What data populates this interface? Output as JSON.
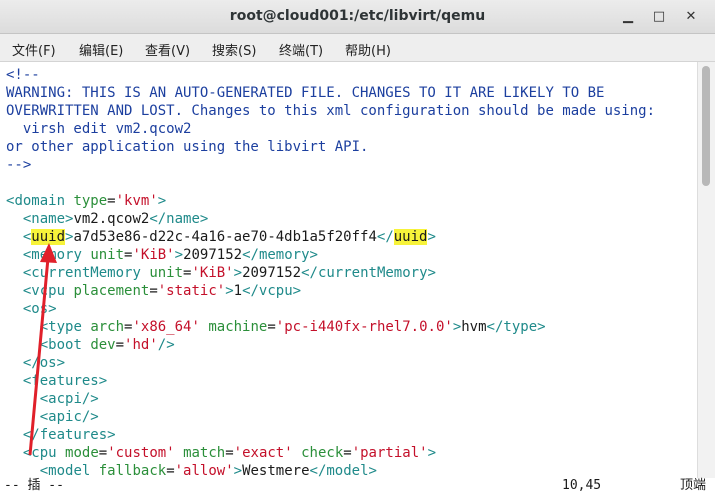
{
  "window": {
    "title": "root@cloud001:/etc/libvirt/qemu"
  },
  "menu": [
    "文件(F)",
    "编辑(E)",
    "查看(V)",
    "搜索(S)",
    "终端(T)",
    "帮助(H)"
  ],
  "editor": {
    "lines": [
      [
        [
          "<!--",
          "c"
        ]
      ],
      [
        [
          "WARNING: THIS IS AN AUTO-GENERATED FILE. CHANGES TO IT ARE LIKELY TO BE",
          "c"
        ]
      ],
      [
        [
          "OVERWRITTEN AND LOST. Changes to this xml configuration should be made using:",
          "c"
        ]
      ],
      [
        [
          "  virsh edit vm2.qcow2",
          "c"
        ]
      ],
      [
        [
          "or other application using the libvirt API.",
          "c"
        ]
      ],
      [
        [
          "-->",
          "c"
        ]
      ],
      [],
      [
        [
          "<",
          "t"
        ],
        [
          "domain",
          "t"
        ],
        [
          " ",
          "x"
        ],
        [
          "type",
          "a"
        ],
        [
          "=",
          "x"
        ],
        [
          "'kvm'",
          "v"
        ],
        [
          ">",
          "t"
        ]
      ],
      [
        [
          "  <",
          "t"
        ],
        [
          "name",
          "t"
        ],
        [
          ">",
          "t"
        ],
        [
          "vm2.qcow2",
          "x"
        ],
        [
          "</",
          "t"
        ],
        [
          "name",
          "t"
        ],
        [
          ">",
          "t"
        ]
      ],
      [
        [
          "  <",
          "t"
        ],
        [
          "uuid",
          "hl"
        ],
        [
          ">",
          "t"
        ],
        [
          "a7d53e86-d22c-4a16-ae70-4db1a5f20ff4",
          "x"
        ],
        [
          "</",
          "t"
        ],
        [
          "uuid",
          "hl"
        ],
        [
          ">",
          "t"
        ]
      ],
      [
        [
          "  <",
          "t"
        ],
        [
          "memory",
          "t"
        ],
        [
          " ",
          "x"
        ],
        [
          "unit",
          "a"
        ],
        [
          "=",
          "x"
        ],
        [
          "'KiB'",
          "v"
        ],
        [
          ">",
          "t"
        ],
        [
          "2097152",
          "x"
        ],
        [
          "</",
          "t"
        ],
        [
          "memory",
          "t"
        ],
        [
          ">",
          "t"
        ]
      ],
      [
        [
          "  <",
          "t"
        ],
        [
          "currentMemory",
          "t"
        ],
        [
          " ",
          "x"
        ],
        [
          "unit",
          "a"
        ],
        [
          "=",
          "x"
        ],
        [
          "'KiB'",
          "v"
        ],
        [
          ">",
          "t"
        ],
        [
          "2097152",
          "x"
        ],
        [
          "</",
          "t"
        ],
        [
          "currentMemory",
          "t"
        ],
        [
          ">",
          "t"
        ]
      ],
      [
        [
          "  <",
          "t"
        ],
        [
          "vcpu",
          "t"
        ],
        [
          " ",
          "x"
        ],
        [
          "placement",
          "a"
        ],
        [
          "=",
          "x"
        ],
        [
          "'static'",
          "v"
        ],
        [
          ">",
          "t"
        ],
        [
          "1",
          "x"
        ],
        [
          "</",
          "t"
        ],
        [
          "vcpu",
          "t"
        ],
        [
          ">",
          "t"
        ]
      ],
      [
        [
          "  <",
          "t"
        ],
        [
          "os",
          "t"
        ],
        [
          ">",
          "t"
        ]
      ],
      [
        [
          "    <",
          "t"
        ],
        [
          "type",
          "t"
        ],
        [
          " ",
          "x"
        ],
        [
          "arch",
          "a"
        ],
        [
          "=",
          "x"
        ],
        [
          "'x86_64'",
          "v"
        ],
        [
          " ",
          "x"
        ],
        [
          "machine",
          "a"
        ],
        [
          "=",
          "x"
        ],
        [
          "'pc-i440fx-rhel7.0.0'",
          "v"
        ],
        [
          ">",
          "t"
        ],
        [
          "hvm",
          "x"
        ],
        [
          "</",
          "t"
        ],
        [
          "type",
          "t"
        ],
        [
          ">",
          "t"
        ]
      ],
      [
        [
          "    <",
          "t"
        ],
        [
          "boot",
          "t"
        ],
        [
          " ",
          "x"
        ],
        [
          "dev",
          "a"
        ],
        [
          "=",
          "x"
        ],
        [
          "'hd'",
          "v"
        ],
        [
          "/>",
          "t"
        ]
      ],
      [
        [
          "  </",
          "t"
        ],
        [
          "os",
          "t"
        ],
        [
          ">",
          "t"
        ]
      ],
      [
        [
          "  <",
          "t"
        ],
        [
          "features",
          "t"
        ],
        [
          ">",
          "t"
        ]
      ],
      [
        [
          "    <",
          "t"
        ],
        [
          "acpi",
          "t"
        ],
        [
          "/>",
          "t"
        ]
      ],
      [
        [
          "    <",
          "t"
        ],
        [
          "apic",
          "t"
        ],
        [
          "/>",
          "t"
        ]
      ],
      [
        [
          "  </",
          "t"
        ],
        [
          "features",
          "t"
        ],
        [
          ">",
          "t"
        ]
      ],
      [
        [
          "  <",
          "t"
        ],
        [
          "cpu",
          "t"
        ],
        [
          " ",
          "x"
        ],
        [
          "mode",
          "a"
        ],
        [
          "=",
          "x"
        ],
        [
          "'custom'",
          "v"
        ],
        [
          " ",
          "x"
        ],
        [
          "match",
          "a"
        ],
        [
          "=",
          "x"
        ],
        [
          "'exact'",
          "v"
        ],
        [
          " ",
          "x"
        ],
        [
          "check",
          "a"
        ],
        [
          "=",
          "x"
        ],
        [
          "'partial'",
          "v"
        ],
        [
          ">",
          "t"
        ]
      ],
      [
        [
          "    <",
          "t"
        ],
        [
          "model",
          "t"
        ],
        [
          " ",
          "x"
        ],
        [
          "fallback",
          "a"
        ],
        [
          "=",
          "x"
        ],
        [
          "'allow'",
          "v"
        ],
        [
          ">",
          "t"
        ],
        [
          "Westmere",
          "x"
        ],
        [
          "</",
          "t"
        ],
        [
          "model",
          "t"
        ],
        [
          ">",
          "t"
        ]
      ]
    ]
  },
  "status": {
    "mode": "-- 插  --",
    "position": "10,45",
    "scroll": "顶端"
  },
  "colors": {
    "comment": "#1c3f9f",
    "tag": "#1f8a8a",
    "attr": "#2b8f3a",
    "value": "#c4102a",
    "highlight": "#f7f33a",
    "arrow": "#e0202a"
  }
}
